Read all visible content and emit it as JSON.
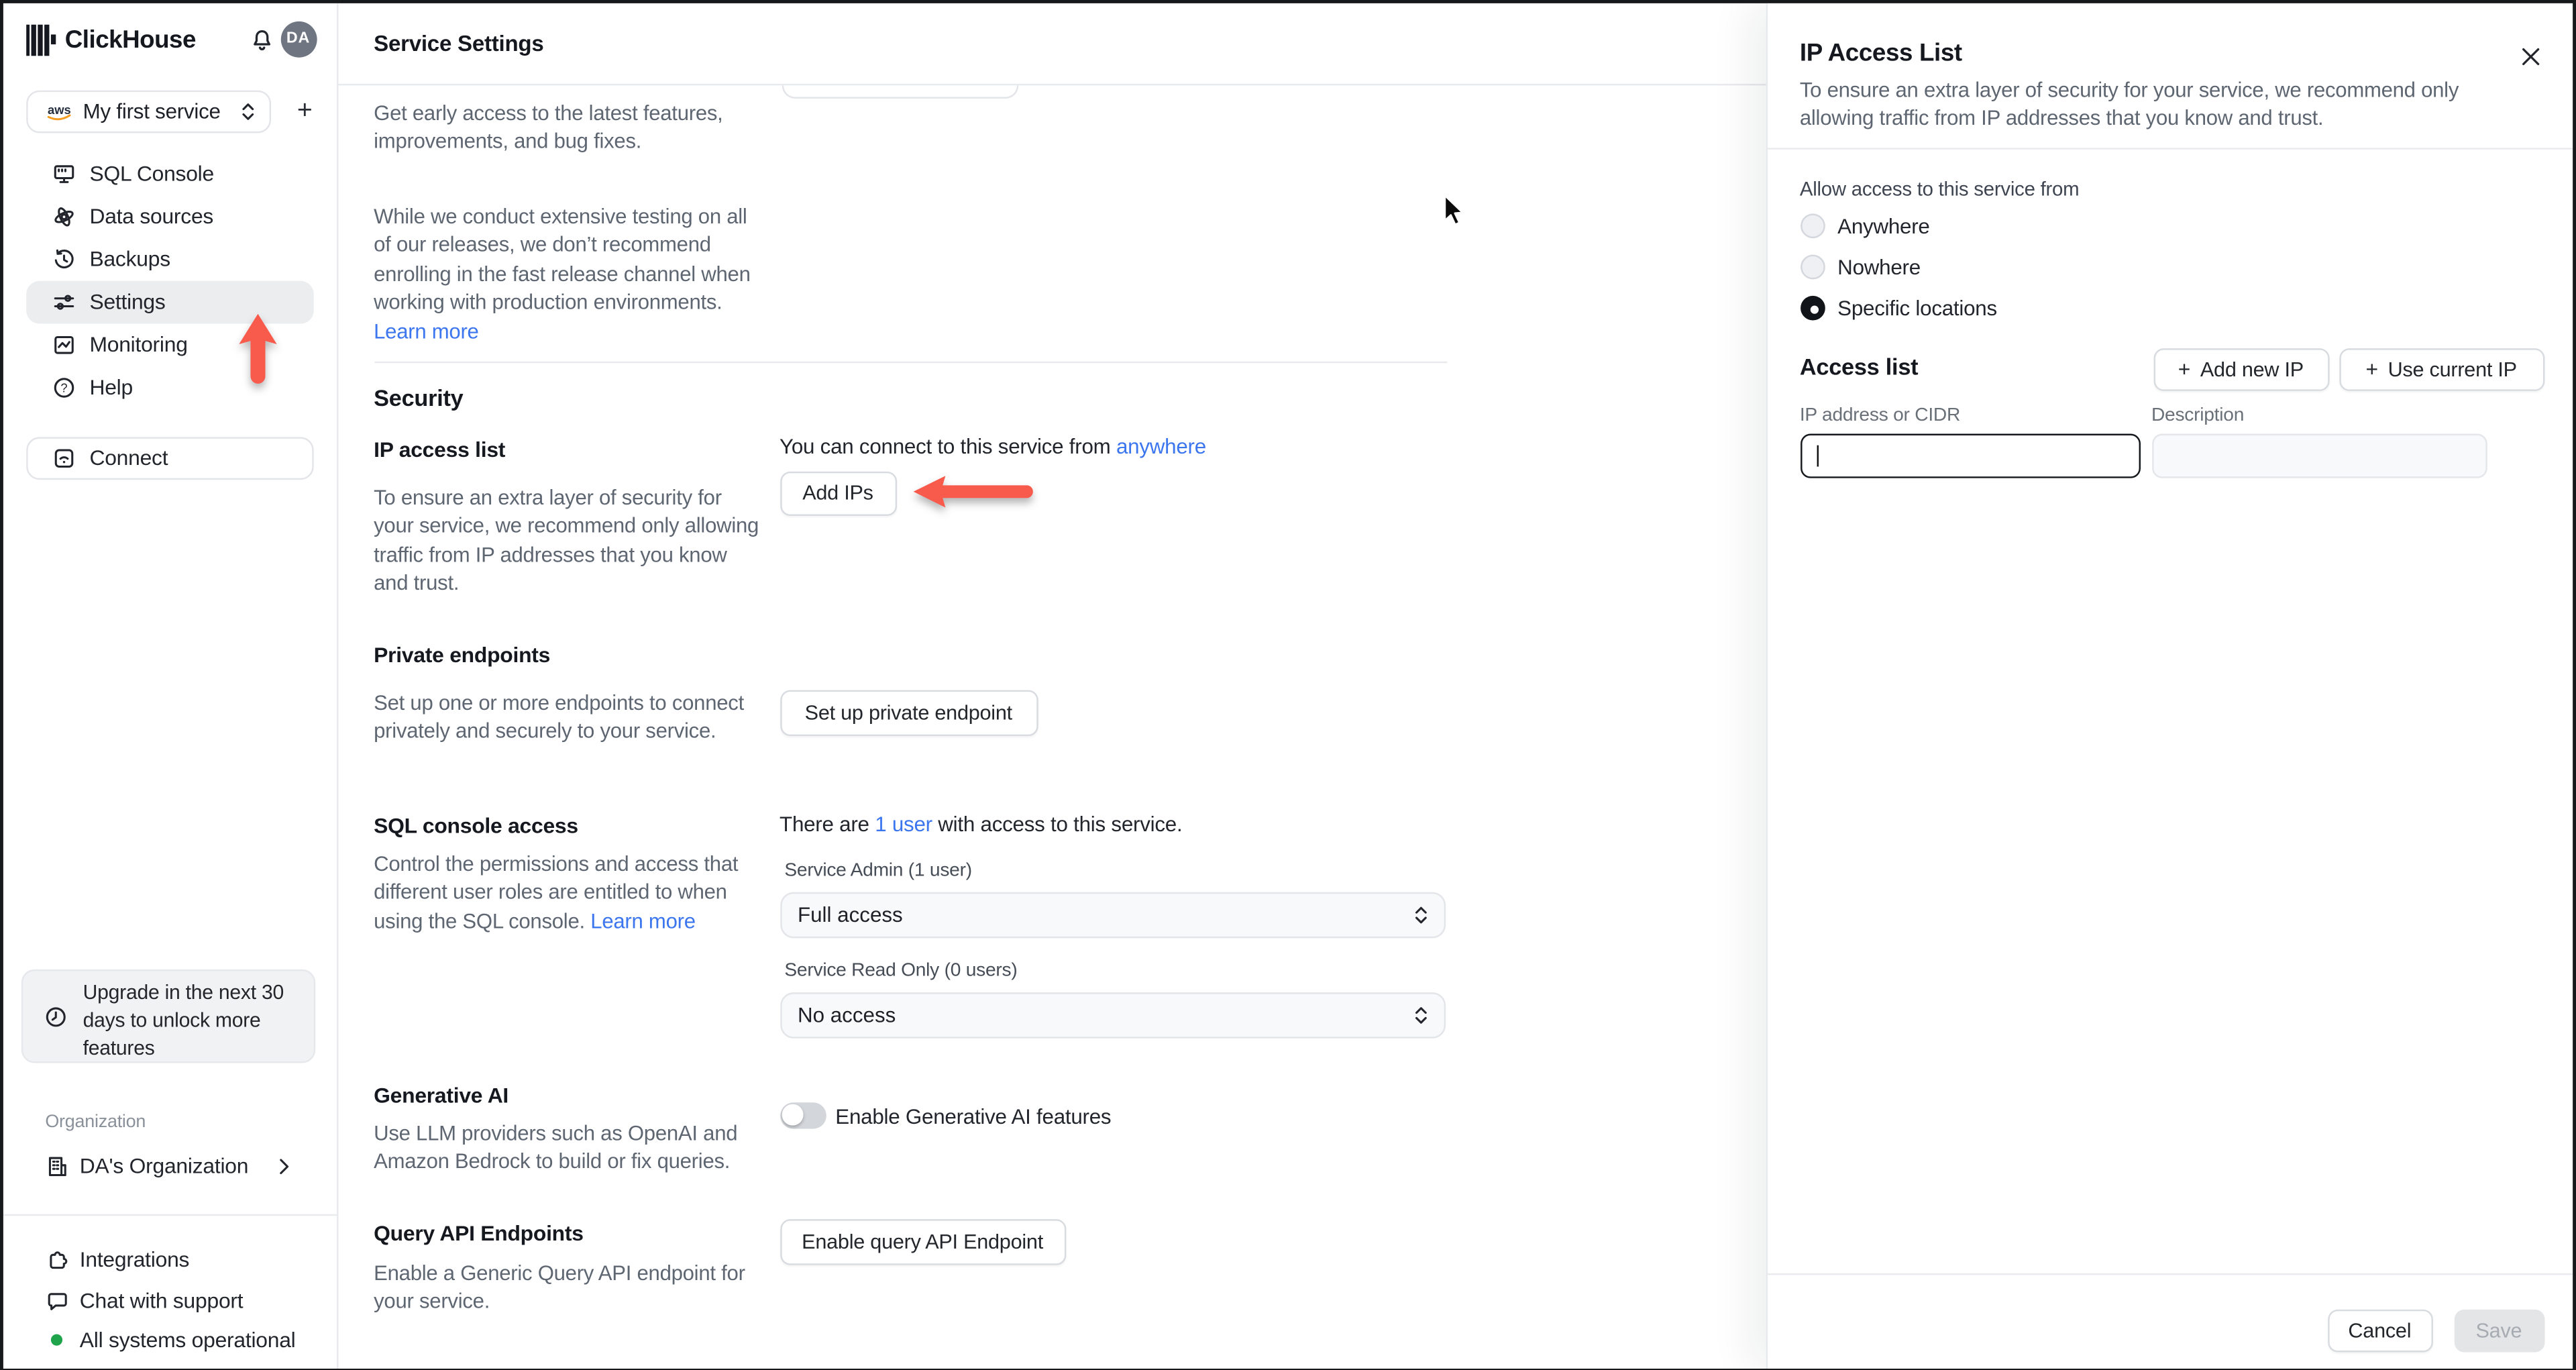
{
  "sidebar": {
    "brand": "ClickHouse",
    "avatar": "DA",
    "service_selector": {
      "provider": "aws",
      "label": "My first service"
    },
    "add_service_label": "+",
    "nav": [
      {
        "label": "SQL Console",
        "icon": "sql-console-icon",
        "active": false
      },
      {
        "label": "Data sources",
        "icon": "data-sources-icon",
        "active": false
      },
      {
        "label": "Backups",
        "icon": "backups-icon",
        "active": false
      },
      {
        "label": "Settings",
        "icon": "settings-icon",
        "active": true
      },
      {
        "label": "Monitoring",
        "icon": "monitoring-icon",
        "active": false
      },
      {
        "label": "Help",
        "icon": "help-icon",
        "active": false
      }
    ],
    "connect_label": "Connect",
    "upgrade_note": "Upgrade in the next 30 days to unlock more features",
    "organization_label": "Organization",
    "organization_name": "DA's Organization",
    "footer": [
      {
        "label": "Integrations",
        "icon": "puzzle-icon"
      },
      {
        "label": "Chat with support",
        "icon": "chat-bubble-icon"
      },
      {
        "label": "All systems operational",
        "icon": "status-dot"
      }
    ]
  },
  "main": {
    "title": "Service Settings",
    "release": {
      "p1": "Get early access to the latest features, improvements, and bug fixes.",
      "p2": "While we conduct extensive testing on all of our releases, we don’t recommend enrolling in the fast release channel when working with production environments. ",
      "learn_more": "Learn more"
    },
    "security": {
      "heading": "Security",
      "ip_access": {
        "title": "IP access list",
        "connect_text_prefix": "You can connect to this service from ",
        "connect_text_link": "anywhere",
        "add_ips": "Add IPs",
        "description": "To ensure an extra layer of security for your service, we recommend only allowing traffic from IP addresses that you know and trust."
      },
      "private_endpoints": {
        "title": "Private endpoints",
        "description": "Set up one or more endpoints to connect privately and securely to your service.",
        "button": "Set up private endpoint"
      },
      "sql_console": {
        "title": "SQL console access",
        "users_prefix": "There are ",
        "users_link": "1 user",
        "users_suffix": " with access to this service.",
        "description": "Control the permissions and access that different user roles are entitled to when using the SQL console. ",
        "learn_more": "Learn more",
        "admin_label": "Service Admin (1 user)",
        "admin_value": "Full access",
        "readonly_label": "Service Read Only (0 users)",
        "readonly_value": "No access"
      },
      "generative_ai": {
        "title": "Generative AI",
        "toggle_label": "Enable Generative AI features",
        "toggle_on": false,
        "description": "Use LLM providers such as OpenAI and Amazon Bedrock to build or fix queries."
      },
      "query_api": {
        "title": "Query API Endpoints",
        "button": "Enable query API Endpoint",
        "description": "Enable a Generic Query API endpoint for your service."
      }
    }
  },
  "panel": {
    "title": "IP Access List",
    "close_label": "×",
    "description": "To ensure an extra layer of security for your service, we recommend only allowing traffic from IP addresses that you know and trust.",
    "allow_label": "Allow access to this service from",
    "options": [
      {
        "label": "Anywhere",
        "selected": false
      },
      {
        "label": "Nowhere",
        "selected": false
      },
      {
        "label": "Specific locations",
        "selected": true
      }
    ],
    "access_list": {
      "heading": "Access list",
      "add_new_ip": "Add new IP",
      "use_current_ip": "Use current IP",
      "ip_label": "IP address or CIDR",
      "desc_label": "Description",
      "ip_value": "",
      "desc_value": ""
    },
    "cancel": "Cancel",
    "save": "Save"
  },
  "colors": {
    "accent_blue": "#3b76ef",
    "arrow_red": "#f85a4c",
    "status_green": "#1fa34b"
  }
}
